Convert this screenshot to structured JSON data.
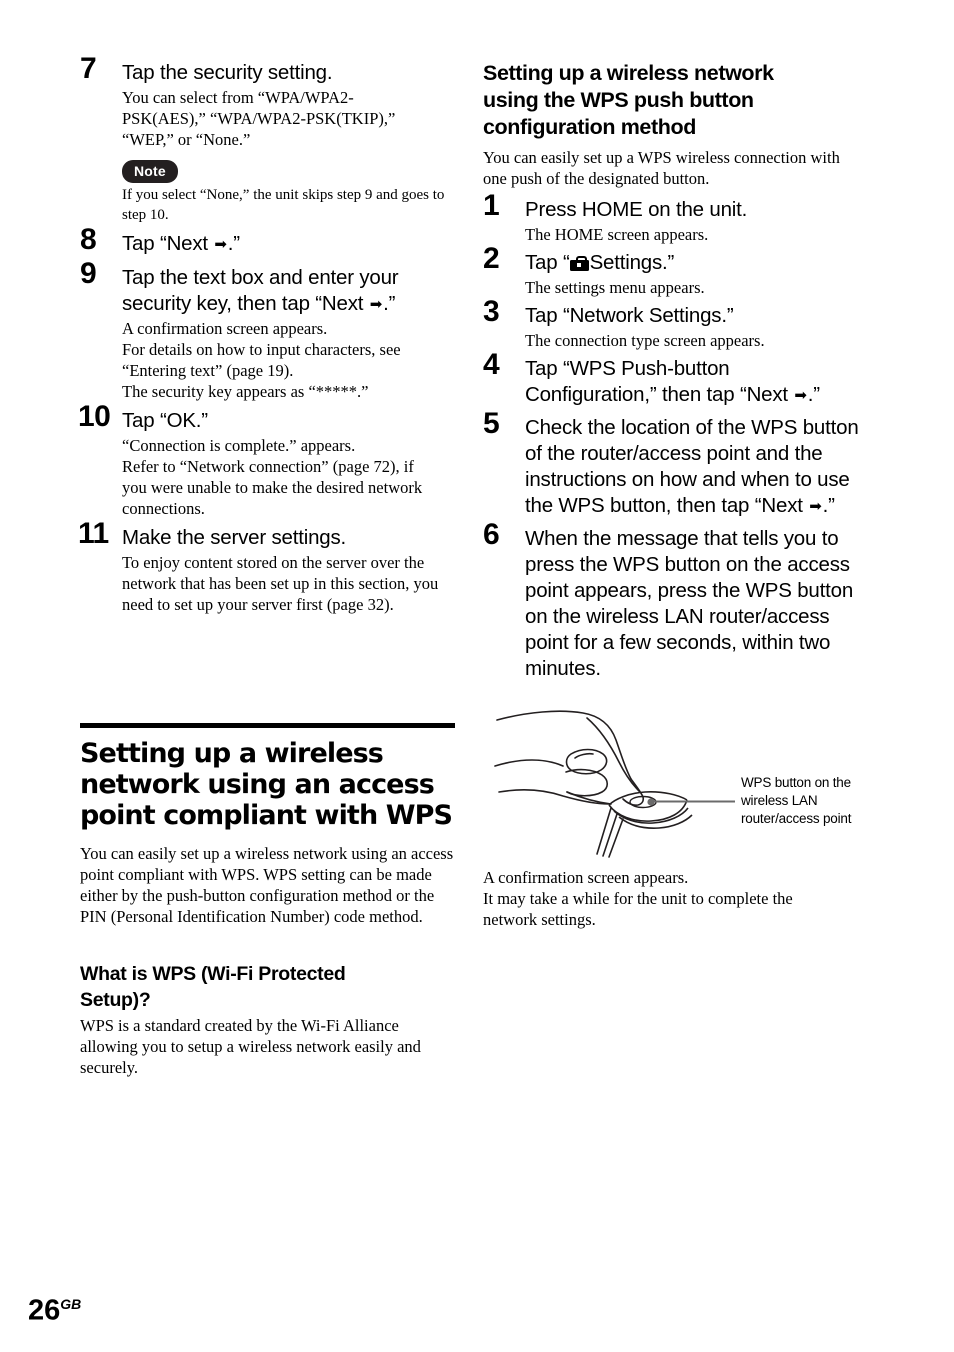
{
  "page": {
    "number": "26",
    "region_suffix": "GB"
  },
  "left_column": {
    "steps": [
      {
        "num": "7",
        "title": "Tap the security setting.",
        "body": "You can select from “WPA/WPA2-PSK(AES),” “WPA/WPA2-PSK(TKIP),” “WEP,” or “None.”"
      },
      {
        "num": "8",
        "title_pre": "Tap “Next ",
        "title_post": ".”",
        "body": ""
      },
      {
        "num": "9",
        "title_pre": "Tap the text box and enter your security key, then tap “Next ",
        "title_post": ".”",
        "body": "A confirmation screen appears.\nFor details on how to input characters, see “Entering text” (page 19).\nThe security key appears as “*****.”"
      },
      {
        "num": "10",
        "title": "Tap “OK.”",
        "body": "“Connection is complete.” appears.\nRefer to “Network connection” (page 72), if you were unable to make the desired network connections."
      },
      {
        "num": "11",
        "title": "Make the server settings.",
        "body": "To enjoy content stored on the server over the network that has been set up in this section, you need to set up your server first (page 32)."
      }
    ],
    "note": {
      "badge": "Note",
      "text": "If you select “None,” the unit skips step 9 and goes to step 10."
    },
    "section": {
      "heading": "Setting up a wireless network using an access point compliant with WPS",
      "paragraph": "You can easily set up a wireless network using an access point compliant with WPS. WPS setting can be made either by the push-button configuration method or the PIN (Personal Identification Number) code method."
    },
    "subsection": {
      "heading": "What is WPS (Wi-Fi Protected Setup)?",
      "paragraph": "WPS is a standard created by the Wi-Fi Alliance allowing you to setup a wireless network easily and securely."
    }
  },
  "right_column": {
    "heading": "Setting up a wireless network using the WPS push button configuration method",
    "intro": "You can easily set up a WPS wireless connection with one push of the designated button.",
    "steps": [
      {
        "num": "1",
        "title": "Press HOME on the unit.",
        "body": "The HOME screen appears."
      },
      {
        "num": "2",
        "title_pre": "Tap “",
        "title_post": "Settings.”",
        "body": "The settings menu appears."
      },
      {
        "num": "3",
        "title": "Tap “Network Settings.”",
        "body": "The connection type screen appears."
      },
      {
        "num": "4",
        "title_pre": "Tap “WPS Push-button Configuration,” then tap “Next ",
        "title_post": ".”",
        "body": ""
      },
      {
        "num": "5",
        "title_pre": "Check the location of the WPS button of the router/access point and the instructions on how and when to use the WPS button, then tap “Next ",
        "title_post": ".”",
        "body": ""
      },
      {
        "num": "6",
        "title": "When the message that tells you to press the WPS button on the access point appears, press the WPS button on the wireless LAN router/access point for a few seconds, within two minutes.",
        "body": ""
      }
    ],
    "figure": {
      "caption": "WPS button on the wireless LAN router/access point",
      "line_color": "#6b6b6b"
    },
    "after_figure": "A confirmation screen appears.\nIt may take a while for the unit to complete the network settings."
  },
  "icons": {
    "arrow_right": "➡",
    "settings_toolbox": "toolbox-icon"
  }
}
